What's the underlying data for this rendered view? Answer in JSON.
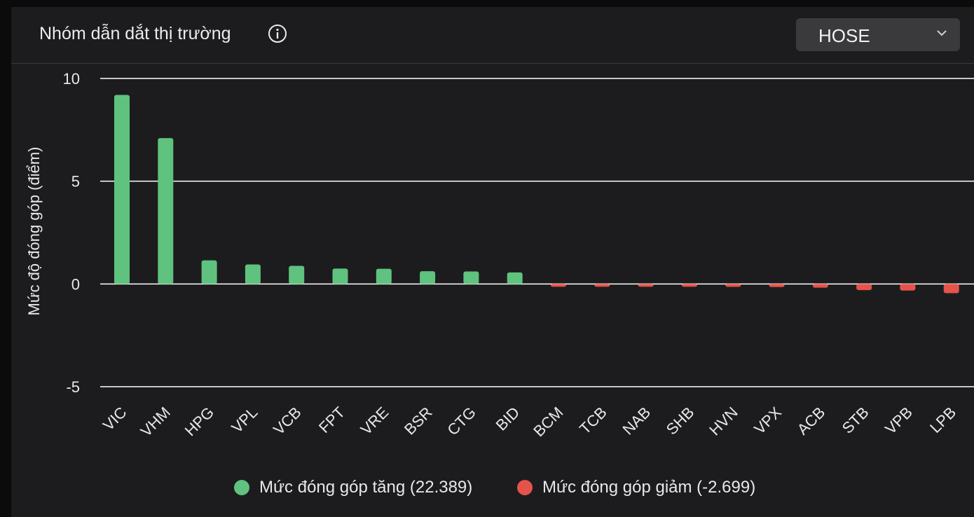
{
  "header": {
    "title": "Nhóm dẫn dắt thị trường",
    "info_icon": "info-circle-icon",
    "exchange_select": {
      "selected": "HOSE",
      "icon": "chevron-down-icon"
    }
  },
  "colors": {
    "up": "#5fc27e",
    "down": "#e5534b",
    "grid": "#ffffff",
    "text": "#e8e8e8"
  },
  "chart_data": {
    "type": "bar",
    "title": "",
    "ylabel": "Mức độ đóng góp (điểm)",
    "xlabel": "",
    "ylim": [
      -5,
      10
    ],
    "yticks": [
      "10",
      "5",
      "0",
      "-5"
    ],
    "grid": true,
    "legend_position": "bottom-center",
    "categories": [
      "VIC",
      "VHM",
      "HPG",
      "VPL",
      "VCB",
      "FPT",
      "VRE",
      "BSR",
      "CTG",
      "BID",
      "BCM",
      "TCB",
      "NAB",
      "SHB",
      "HVN",
      "VPX",
      "ACB",
      "STB",
      "VPB",
      "LPB"
    ],
    "values": [
      9.2,
      7.1,
      1.15,
      0.95,
      0.88,
      0.75,
      0.74,
      0.62,
      0.61,
      0.56,
      -0.07,
      -0.08,
      -0.12,
      -0.13,
      -0.14,
      -0.15,
      -0.18,
      -0.3,
      -0.32,
      -0.45
    ],
    "series": [
      {
        "name": "Mức đóng góp tăng (22.389)"
      },
      {
        "name": "Mức đóng góp giảm (-2.699)"
      }
    ]
  }
}
